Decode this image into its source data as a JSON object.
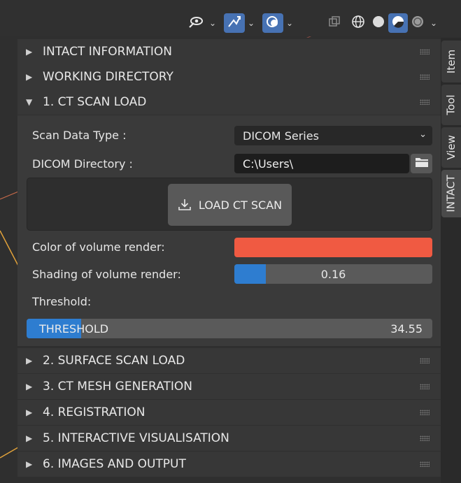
{
  "toolbar": {
    "icons": [
      "eye-selectability-icon",
      "gizmo-icon",
      "overlay-icon",
      "xray-icon",
      "wireframe-shading-icon",
      "solid-shading-icon",
      "material-shading-icon",
      "rendered-shading-icon"
    ]
  },
  "sections_top": [
    {
      "label": "INTACT INFORMATION",
      "expanded": false
    },
    {
      "label": "WORKING DIRECTORY",
      "expanded": false
    },
    {
      "label": "1. CT SCAN LOAD",
      "expanded": true
    }
  ],
  "ct_scan": {
    "scan_type_label": "Scan Data Type :",
    "scan_type_value": "DICOM Series",
    "dicom_dir_label": "DICOM Directory :",
    "dicom_dir_value": "C:\\Users\\",
    "load_button": "LOAD CT SCAN",
    "color_label": "Color of volume render:",
    "color_value": "#f05a42",
    "shading_label": "Shading of volume render:",
    "shading_value": "0.16",
    "shading_fraction": 0.16,
    "threshold_heading": "Threshold:",
    "threshold_label": "THRESHOLD",
    "threshold_value": "34.55",
    "threshold_fraction": 0.135
  },
  "sections_bottom": [
    {
      "label": "2. SURFACE SCAN LOAD",
      "expanded": false
    },
    {
      "label": "3. CT MESH GENERATION",
      "expanded": false
    },
    {
      "label": "4. REGISTRATION",
      "expanded": false
    },
    {
      "label": "5. INTERACTIVE VISUALISATION",
      "expanded": false
    },
    {
      "label": "6. IMAGES AND OUTPUT",
      "expanded": false
    }
  ],
  "side_tabs": [
    "Item",
    "Tool",
    "View",
    "INTACT"
  ],
  "active_tab": "INTACT"
}
